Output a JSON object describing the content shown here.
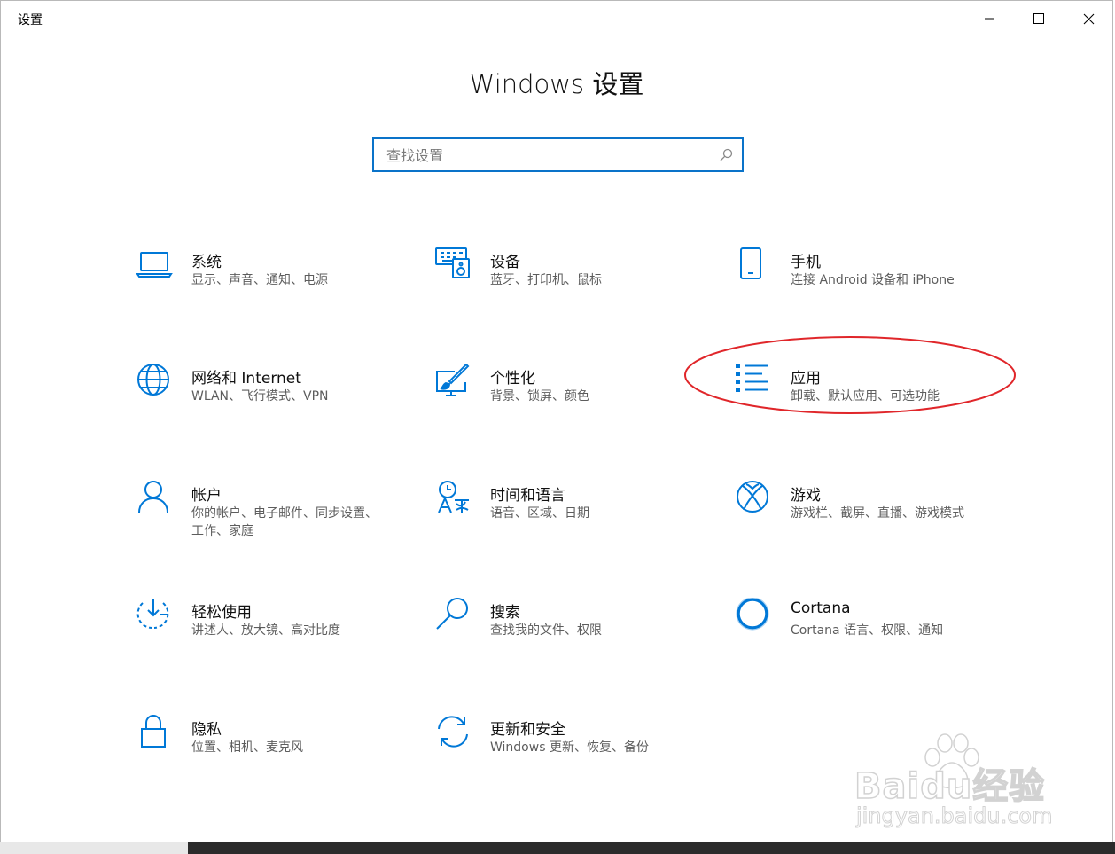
{
  "window": {
    "title": "设置",
    "page_title": "Windows 设置"
  },
  "search": {
    "placeholder": "查找设置"
  },
  "tiles": [
    {
      "title": "系统",
      "desc": "显示、声音、通知、电源",
      "icon": "laptop-icon"
    },
    {
      "title": "设备",
      "desc": "蓝牙、打印机、鼠标",
      "icon": "devices-icon"
    },
    {
      "title": "手机",
      "desc": "连接 Android 设备和 iPhone",
      "icon": "phone-icon"
    },
    {
      "title": "网络和 Internet",
      "desc": "WLAN、飞行模式、VPN",
      "icon": "globe-icon"
    },
    {
      "title": "个性化",
      "desc": "背景、锁屏、颜色",
      "icon": "personalization-icon"
    },
    {
      "title": "应用",
      "desc": "卸载、默认应用、可选功能",
      "icon": "apps-list-icon"
    },
    {
      "title": "帐户",
      "desc": "你的帐户、电子邮件、同步设置、工作、家庭",
      "icon": "person-icon"
    },
    {
      "title": "时间和语言",
      "desc": "语音、区域、日期",
      "icon": "time-language-icon"
    },
    {
      "title": "游戏",
      "desc": "游戏栏、截屏、直播、游戏模式",
      "icon": "xbox-icon"
    },
    {
      "title": "轻松使用",
      "desc": "讲述人、放大镜、高对比度",
      "icon": "ease-of-access-icon"
    },
    {
      "title": "搜索",
      "desc": "查找我的文件、权限",
      "icon": "search-magnifier-icon"
    },
    {
      "title": "Cortana",
      "desc": "Cortana 语言、权限、通知",
      "icon": "cortana-icon"
    },
    {
      "title": "隐私",
      "desc": "位置、相机、麦克风",
      "icon": "lock-icon"
    },
    {
      "title": "更新和安全",
      "desc": "Windows 更新、恢复、备份",
      "icon": "sync-icon"
    }
  ],
  "watermark": {
    "brand": "Baidu经验",
    "url": "jingyan.baidu.com"
  },
  "colors": {
    "accent": "#0078d7",
    "highlight_ellipse": "#e0262a"
  }
}
